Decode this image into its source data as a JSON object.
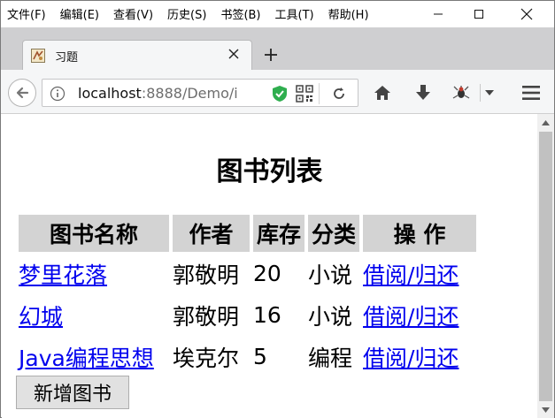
{
  "menu": [
    "文件(F)",
    "编辑(E)",
    "查看(V)",
    "历史(S)",
    "书签(B)",
    "工具(T)",
    "帮助(H)"
  ],
  "tab": {
    "title": "习题"
  },
  "url": {
    "host": "localhost",
    "rest": ":8888/Demo/i"
  },
  "page": {
    "title": "图书列表",
    "headers": [
      "图书名称",
      "作者",
      "库存",
      "分类",
      "操  作"
    ],
    "rows": [
      {
        "name": "梦里花落",
        "author": "郭敬明",
        "stock": "20",
        "category": "小说",
        "action": "借阅/归还"
      },
      {
        "name": "幻城",
        "author": "郭敬明",
        "stock": "16",
        "category": "小说",
        "action": "借阅/归还"
      },
      {
        "name": "Java编程思想",
        "author": "埃克尔",
        "stock": "5",
        "category": "编程",
        "action": "借阅/归还"
      }
    ],
    "add_button": "新增图书"
  },
  "colors": {
    "link": "#0000ee",
    "header_bg": "#d3d3d3",
    "tabstrip": "#cfcfd1"
  },
  "icons": [
    "minimize-icon",
    "maximize-icon",
    "close-icon",
    "favicon-icon",
    "tab-close-icon",
    "new-tab-icon",
    "back-icon",
    "info-icon",
    "shield-icon",
    "qr-code-icon",
    "reload-icon",
    "home-icon",
    "download-icon",
    "extension-icon",
    "dropdown-icon",
    "menu-icon"
  ]
}
